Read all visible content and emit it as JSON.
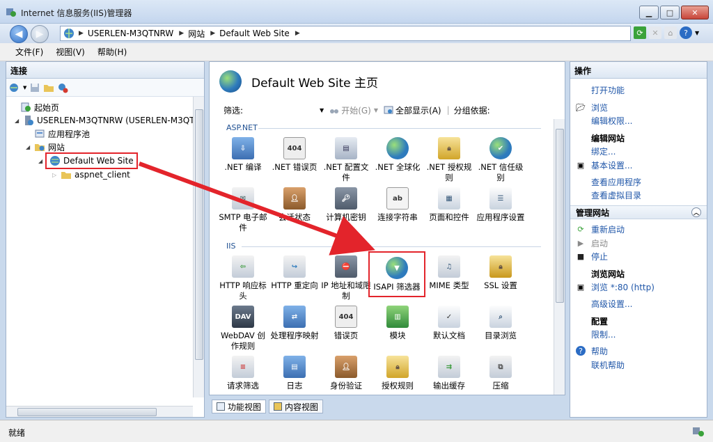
{
  "window": {
    "title": "Internet 信息服务(IIS)管理器"
  },
  "address": {
    "segments": [
      "USERLEN-M3QTNRW",
      "网站",
      "Default Web Site"
    ]
  },
  "menu": [
    "文件(F)",
    "视图(V)",
    "帮助(H)"
  ],
  "left": {
    "header": "连接",
    "tree": {
      "start_page": "起始页",
      "server": "USERLEN-M3QTNRW (USERLEN-M3QT",
      "app_pools": "应用程序池",
      "sites": "网站",
      "default_site": "Default Web Site",
      "aspnet_client": "aspnet_client"
    }
  },
  "center": {
    "title": "Default Web Site 主页",
    "filter": {
      "label": "筛选:",
      "start": "开始(G)",
      "show_all": "全部显示(A)",
      "group_by": "分组依据:"
    },
    "groups": [
      {
        "name": "ASP.NET"
      },
      {
        "name": "IIS"
      }
    ],
    "features": {
      "r1": [
        ".NET 编译",
        ".NET 错误页",
        ".NET 配置文件",
        ".NET 全球化",
        ".NET 授权规则",
        ".NET 信任级别"
      ],
      "r2": [
        "SMTP 电子邮件",
        "会话状态",
        "计算机密钥",
        "连接字符串",
        "页面和控件",
        "应用程序设置"
      ],
      "r3": [
        "HTTP 响应标头",
        "HTTP 重定向",
        "IP 地址和域限制",
        "ISAPI 筛选器",
        "MIME 类型",
        "SSL 设置"
      ],
      "r4": [
        "WebDAV 创作规则",
        "处理程序映射",
        "错误页",
        "模块",
        "默认文档",
        "目录浏览"
      ],
      "r5": [
        "请求筛选",
        "日志",
        "身份验证",
        "授权规则",
        "输出缓存",
        "压缩"
      ]
    },
    "icon_badges": {
      "error404": "404",
      "webdav": "DAV",
      "text_ab": "ab"
    },
    "view_tabs": {
      "features": "功能视图",
      "content": "内容视图"
    }
  },
  "right": {
    "header": "操作",
    "actions": {
      "open_feature": "打开功能",
      "explore": "浏览",
      "edit_perms": "编辑权限...",
      "edit_site": "编辑网站",
      "bindings": "绑定...",
      "basic_settings": "基本设置...",
      "view_apps": "查看应用程序",
      "view_vdirs": "查看虚拟目录",
      "manage_site": "管理网站",
      "restart": "重新启动",
      "start": "启动",
      "stop": "停止",
      "browse_site": "浏览网站",
      "browse_80": "浏览 *:80 (http)",
      "advanced": "高级设置...",
      "configure": "配置",
      "limits": "限制...",
      "help": "帮助",
      "online_help": "联机帮助"
    }
  },
  "status": {
    "text": "就绪"
  },
  "colors": {
    "highlight": "#e3242b",
    "link": "#1f56a8",
    "pane_border": "#9fb2cb"
  }
}
